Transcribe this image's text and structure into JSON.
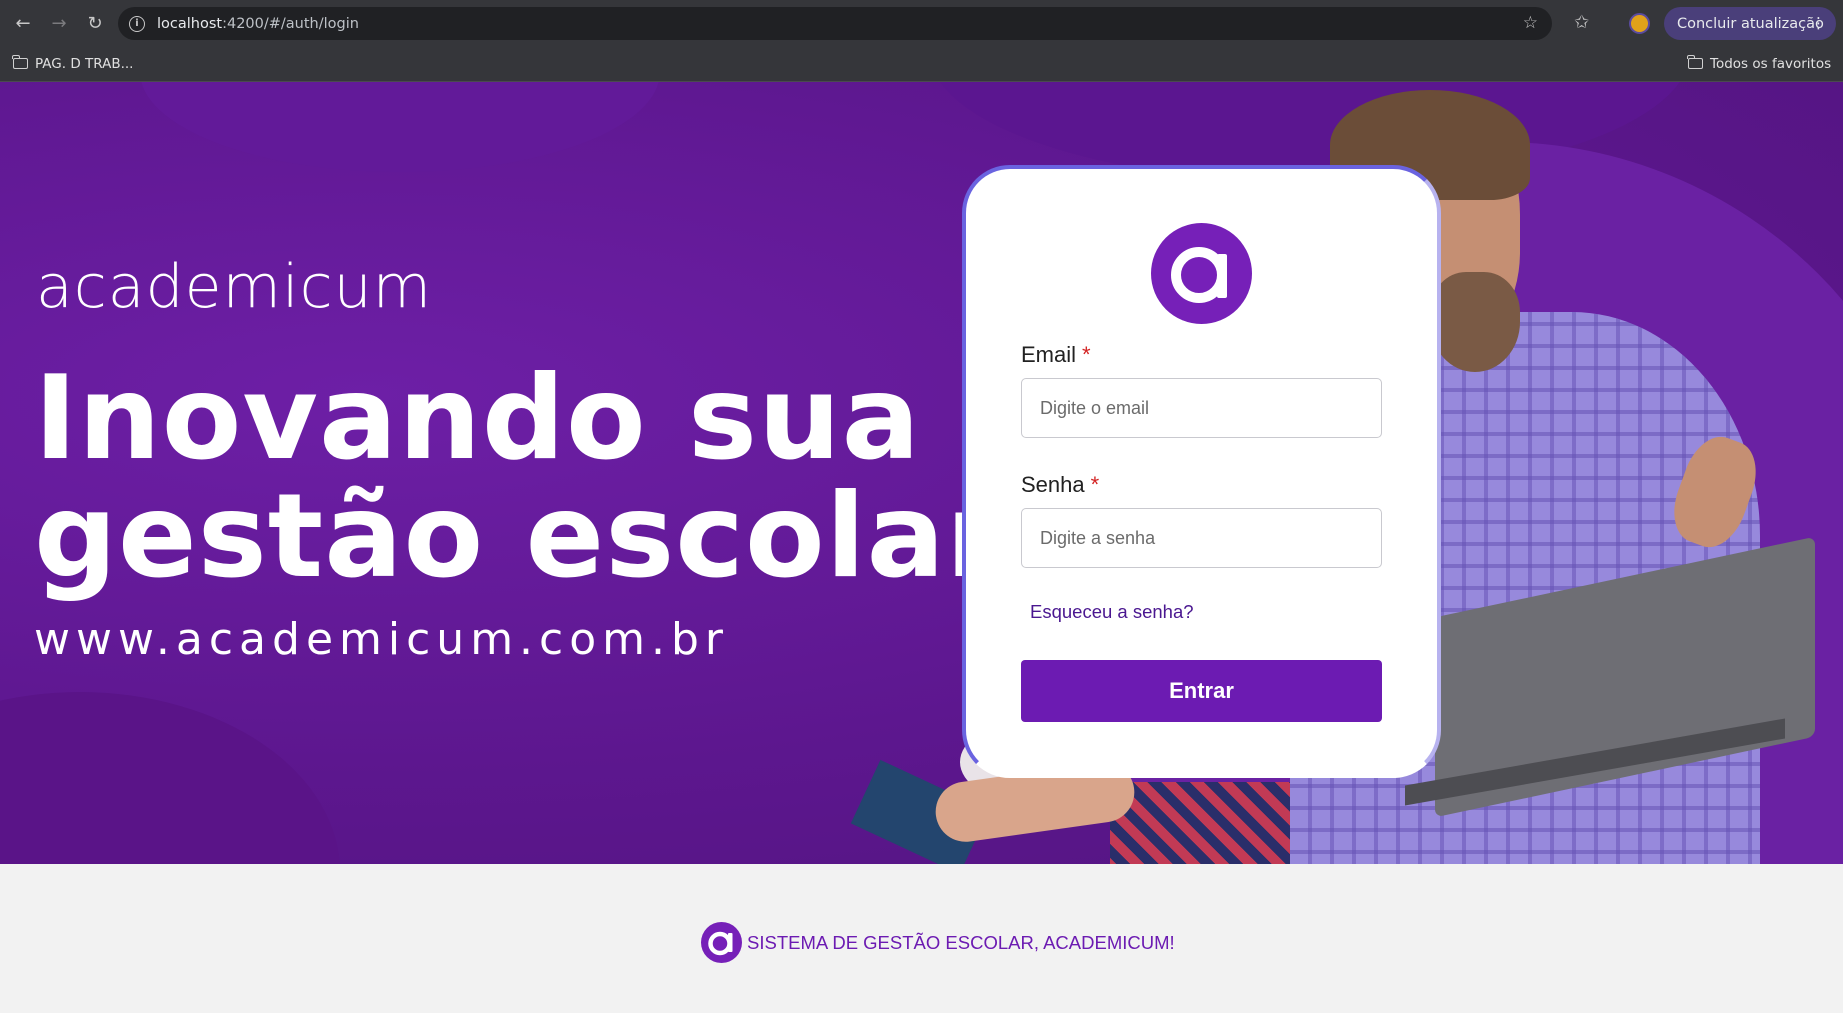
{
  "browser": {
    "url_host": "localhost",
    "url_path": ":4200/#/auth/login",
    "update_label": "Concluir atualização",
    "bookmarks": [
      {
        "label": "PAG. D TRAB..."
      }
    ],
    "all_bookmarks_label": "Todos os favoritos"
  },
  "hero": {
    "brand": "academicum",
    "headline_line1": "Inovando sua",
    "headline_line2": "gestão escolar!",
    "website": "www.academicum.com.br"
  },
  "login": {
    "email_label": "Email",
    "email_placeholder": "Digite o email",
    "email_value": "",
    "password_label": "Senha",
    "password_placeholder": "Digite a senha",
    "password_value": "",
    "required_mark": "*",
    "forgot_link": "Esqueceu a senha?",
    "submit_label": "Entrar"
  },
  "footer": {
    "text": "SISTEMA DE GESTÃO ESCOLAR, ACADEMICUM!"
  },
  "colors": {
    "brand_purple": "#6c1bb2",
    "hero_background": "#5d178f",
    "required_red": "#d32222",
    "card_border": "#6a63e0"
  },
  "icons": {
    "back": "arrow-left-icon",
    "forward": "arrow-right-icon",
    "reload": "reload-icon",
    "site_info": "info-icon",
    "bookmark_star": "star-icon",
    "extensions": "star-outline-icon",
    "profile": "avatar-icon",
    "menu": "more-vertical-icon",
    "folder": "folder-icon",
    "logo": "academicum-logo-icon"
  }
}
